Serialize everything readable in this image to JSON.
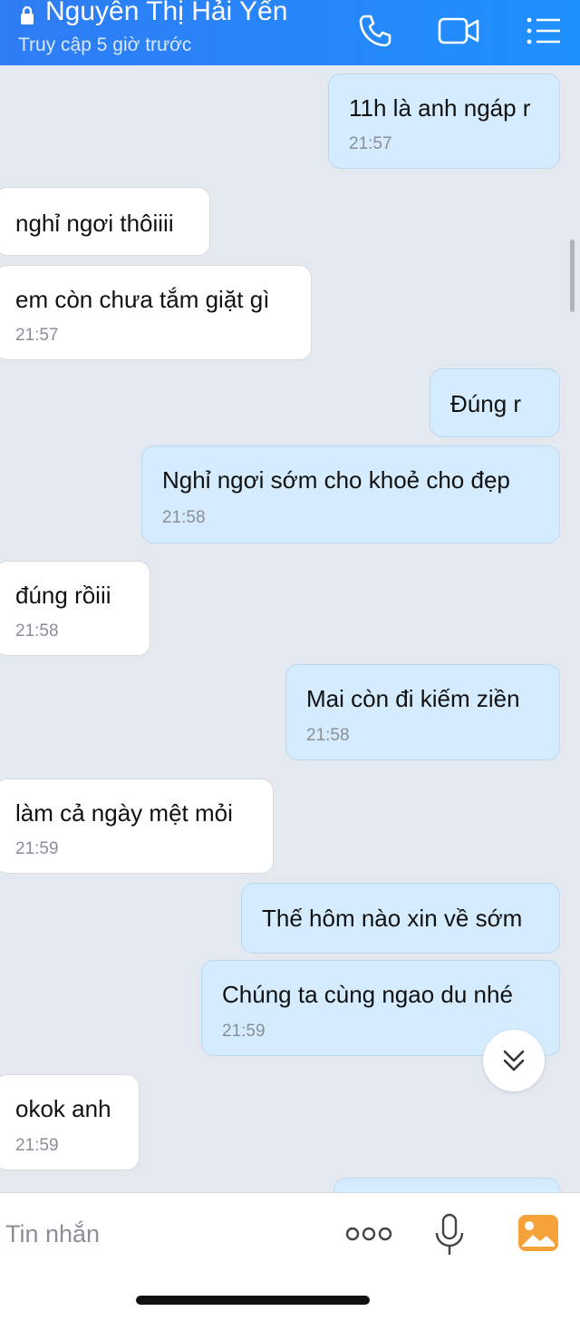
{
  "header": {
    "contact_name": "Nguyễn Thị Hải Yến",
    "status": "Truy cập 5 giờ trước",
    "icons": [
      "lock-icon",
      "phone-icon",
      "video-call-icon",
      "menu-list-icon"
    ]
  },
  "messages": [
    {
      "dir": "out",
      "text": "11h là anh ngáp r",
      "time": "21:57"
    },
    {
      "dir": "in",
      "text": "nghỉ ngơi thôiiii",
      "time": ""
    },
    {
      "dir": "in",
      "text": "em còn chưa tắm giặt gì",
      "time": "21:57"
    },
    {
      "dir": "out",
      "text": "Đúng r",
      "time": ""
    },
    {
      "dir": "out",
      "text": "Nghỉ ngơi sớm cho khoẻ cho đẹp",
      "time": "21:58"
    },
    {
      "dir": "in",
      "text": " đúng rồiii",
      "time": "21:58"
    },
    {
      "dir": "out",
      "text": "Mai còn đi kiếm ziền",
      "time": "21:58"
    },
    {
      "dir": "in",
      "text": "làm cả ngày mệt mỏi",
      "time": "21:59"
    },
    {
      "dir": "out",
      "text": "Thế hôm nào xin về sớm",
      "time": ""
    },
    {
      "dir": "out",
      "text": "Chúng ta cùng ngao du nhé",
      "time": "21:59"
    },
    {
      "dir": "in",
      "text": "okok anh",
      "time": "21:59"
    },
    {
      "dir": "out",
      "text": "",
      "time": ""
    }
  ],
  "input": {
    "placeholder": "Tin nhắn",
    "icons": [
      "more-options-icon",
      "microphone-icon",
      "photo-gallery-icon"
    ]
  },
  "colors": {
    "header": "#1f8bff",
    "chat_background": "#e4e8ef",
    "incoming_bubble": "#ffffff",
    "outgoing_bubble": "#d4ecfd",
    "photo_icon": "#f6a23a"
  }
}
